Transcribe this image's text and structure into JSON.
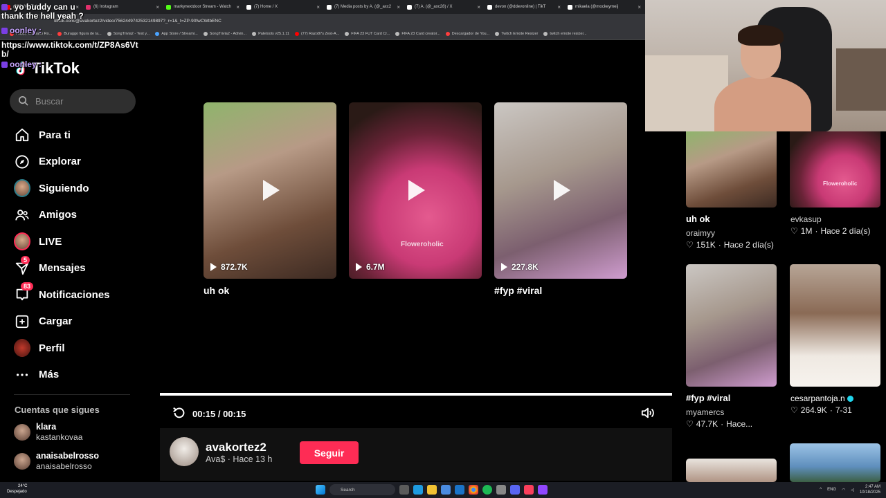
{
  "browser": {
    "tabs": [
      {
        "label": "(220) YouTube",
        "color": "#ff0000"
      },
      {
        "label": "(6) Instagram",
        "color": "#e1306c"
      },
      {
        "label": "markynextdoor Stream - Watch",
        "color": "#53fc18"
      },
      {
        "label": "(7) Home / X",
        "color": "#ffffff"
      },
      {
        "label": "(7) Media posts by A. (@_axc2",
        "color": "#ffffff"
      },
      {
        "label": "(7) A. (@_axc28) / X",
        "color": "#ffffff"
      },
      {
        "label": "devon (@ddevonline) | TikT",
        "color": "#ffffff"
      },
      {
        "label": "mikaela (@mockeymeij",
        "color": "#ffffff"
      }
    ],
    "address": "tiktok.com/@avakortez2/video/7562449742532149897?_r=1&_t=ZP-90fwCWtbENC",
    "bookmarks": [
      {
        "label": "Happy Cristiano Ro...",
        "color": "#ff3d3d"
      },
      {
        "label": "Buraggo figura de ta...",
        "color": "#ff3d3d"
      },
      {
        "label": "SongTrivia2 - Test y...",
        "color": "#bbbbbb"
      },
      {
        "label": "App Store / Streami...",
        "color": "#4aa3ff"
      },
      {
        "label": "SongTrivia2 - Adivin...",
        "color": "#bbbbbb"
      },
      {
        "label": "Paletools v25.1.11",
        "color": "#bbbbbb"
      },
      {
        "label": "(77) Razo87s Zest-A...",
        "color": "#ff0000"
      },
      {
        "label": "FIFA 23 FUT Card Cr...",
        "color": "#bbbbbb"
      },
      {
        "label": "FIFA 23 Card creator...",
        "color": "#bbbbbb"
      },
      {
        "label": "Descargador de You...",
        "color": "#ff3d3d"
      },
      {
        "label": "Twitch Emote Resizer",
        "color": "#bbbbbb"
      },
      {
        "label": "twitch emote resizer...",
        "color": "#bbbbbb"
      }
    ]
  },
  "chat": {
    "line1": ". yo buddy can u",
    "line2": "thank the hell yeah ?",
    "user": "oonley :",
    "link": "https://www.tiktok.com/t/ZP8As6Vt",
    "link2": "b/",
    "user2": "oonley :"
  },
  "sidebar": {
    "logo": "TikTok",
    "search_placeholder": "Buscar",
    "items": [
      {
        "label": "Para ti",
        "icon": "home-icon"
      },
      {
        "label": "Explorar",
        "icon": "compass-icon"
      },
      {
        "label": "Siguiendo",
        "icon": "avatar"
      },
      {
        "label": "Amigos",
        "icon": "friends-icon"
      },
      {
        "label": "LIVE",
        "icon": "avatar"
      },
      {
        "label": "Mensajes",
        "icon": "send-icon",
        "badge": "5"
      },
      {
        "label": "Notificaciones",
        "icon": "inbox-icon",
        "badge": "83"
      },
      {
        "label": "Cargar",
        "icon": "plus-square-icon"
      },
      {
        "label": "Perfil",
        "icon": "avatar"
      },
      {
        "label": "Más",
        "icon": "more-icon"
      }
    ],
    "following_heading": "Cuentas que sigues",
    "following": [
      {
        "name": "klara",
        "sub": "kastankovaa"
      },
      {
        "name": "anaisabelrosso",
        "sub": "anaisabelrosso"
      }
    ]
  },
  "grid": [
    {
      "views": "872.7K",
      "title": "uh ok"
    },
    {
      "views": "6.7M",
      "title": "",
      "watermark": "Floweroholic"
    },
    {
      "views": "227.8K",
      "title": "#fyp #viral"
    }
  ],
  "player": {
    "time": "00:15 / 00:15",
    "progress": 1.0
  },
  "author": {
    "name": "avakortez2",
    "sub": "Ava$ · Hace 13 h",
    "follow_label": "Seguir"
  },
  "right_column": [
    {
      "title": "uh ok",
      "user": "oraimyy",
      "likes": "151K",
      "when": "Hace 2 día(s)"
    },
    {
      "title": "",
      "user": "evkasup",
      "likes": "1M",
      "when": "Hace 2 día(s)",
      "watermark": "Floweroholic"
    },
    {
      "title": "#fyp #viral",
      "user": "myamercs",
      "likes": "47.7K",
      "when": "Hace..."
    },
    {
      "title": "",
      "user": "cesarpantoja.n",
      "likes": "264.9K",
      "when": "7-31",
      "verified": true
    }
  ],
  "taskbar": {
    "weather_temp": "24°C",
    "weather_desc": "Despejado",
    "search": "Search",
    "lang": "ENG",
    "time": "2:47 AM",
    "date": "10/18/2025"
  }
}
